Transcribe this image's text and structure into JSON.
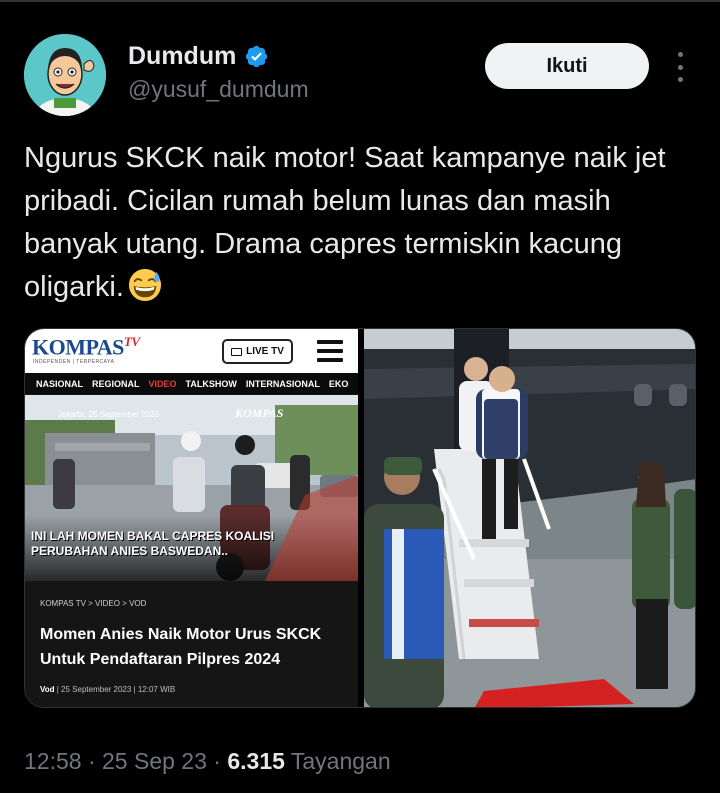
{
  "user": {
    "display_name": "Dumdum",
    "handle": "@yusuf_dumdum",
    "verified_icon": "verified-badge-icon",
    "avatar_icon": "cartoon-avatar"
  },
  "actions": {
    "follow_label": "Ikuti",
    "more_icon": "more-vertical-icon"
  },
  "tweet": {
    "text": "Ngurus SKCK naik motor! Saat kampanye naik jet pribadi. Cicilan rumah belum lunas dan masih banyak utang. Drama capres termiskin kacung oligarki.",
    "emoji_icon": "grinning-sweat-emoji-icon"
  },
  "media": {
    "left": {
      "logo": "KOMPAS",
      "logo_suffix": "TV",
      "tagline": "INDEPENDEN | TERPERCAYA",
      "live_label": "LIVE TV",
      "nav": [
        "NASIONAL",
        "REGIONAL",
        "VIDEO",
        "TALKSHOW",
        "INTERNASIONAL",
        "EKO"
      ],
      "nav_active": "VIDEO",
      "photo_date": "Jakarta, 25 September 2023",
      "photo_logo": "KOMPAS",
      "caption_line1": "INI LAH MOMEN BAKAL CAPRES KOALISI",
      "caption_line2": "PERUBAHAN ANIES BASWEDAN..",
      "breadcrumb": "KOMPAS TV > VIDEO > VOD",
      "title": "Momen Anies Naik Motor Urus SKCK Untuk Pendaftaran Pilpres 2024",
      "meta_category": "Vod",
      "meta_rest": "| 25 September 2023 | 12:07 WIB"
    }
  },
  "footer": {
    "time": "12:58",
    "date": "25 Sep 23",
    "views": "6.315",
    "views_label": "Tayangan"
  },
  "colors": {
    "background": "#000000",
    "text_primary": "#e7e9ea",
    "text_secondary": "#71767b",
    "verified": "#1d9bf0",
    "follow_bg": "#eff3f4"
  }
}
